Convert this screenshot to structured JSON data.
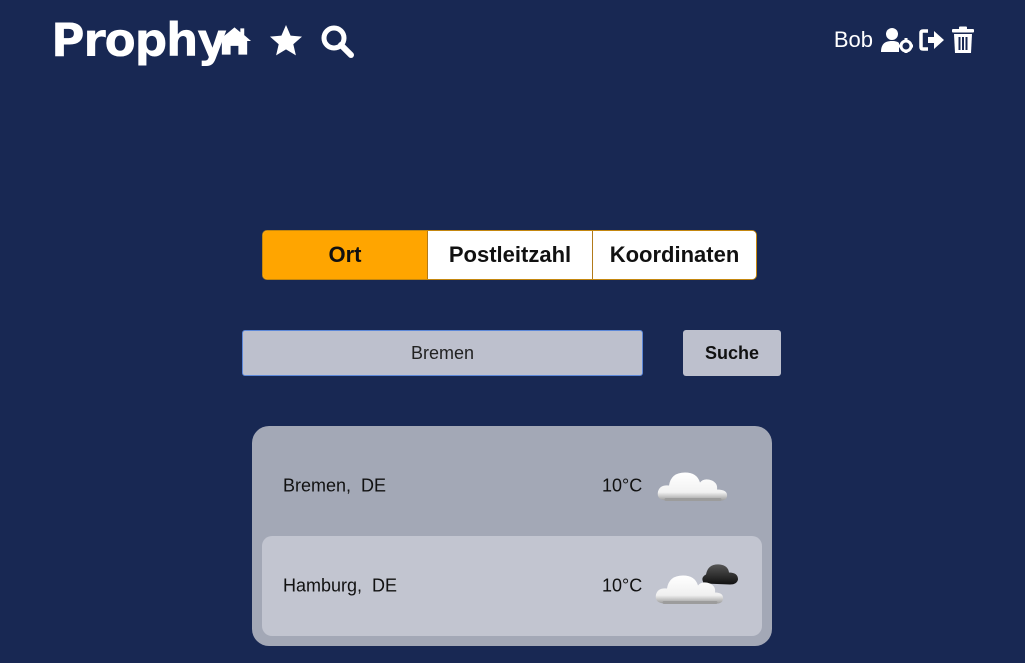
{
  "header": {
    "brand": "Prophy",
    "nav_icons": [
      "home-icon",
      "star-icon",
      "search-icon"
    ],
    "user": {
      "name": "Bob",
      "icons": [
        "user-settings-icon",
        "logout-icon",
        "trash-icon"
      ]
    }
  },
  "search": {
    "modes": [
      {
        "label": "Ort",
        "active": true
      },
      {
        "label": "Postleitzahl",
        "active": false
      },
      {
        "label": "Koordinaten",
        "active": false
      }
    ],
    "input_value": "Bremen",
    "button_label": "Suche"
  },
  "results": [
    {
      "location": "Bremen,  DE",
      "temperature": "10°C",
      "icon": "cloud-icon"
    },
    {
      "location": "Hamburg,  DE",
      "temperature": "10°C",
      "icon": "dark-cloud-icon"
    }
  ],
  "colors": {
    "background": "#182853",
    "accent": "#ffa500",
    "panel": "#a3a8b6",
    "input_bg": "#bdc0cd"
  }
}
